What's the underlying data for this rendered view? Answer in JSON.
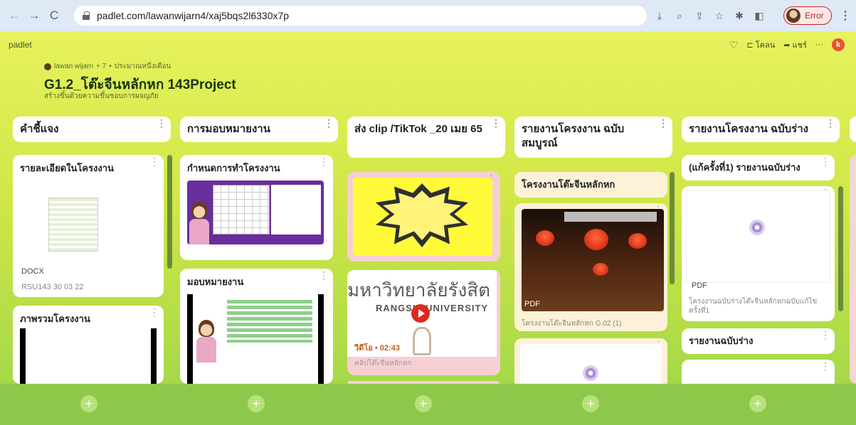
{
  "browser": {
    "url": "padlet.com/lawanwijarn4/xaj5bqs2l6330x7p",
    "profile_label": "Error"
  },
  "padlet": {
    "logo": "padlet",
    "top_actions": {
      "remake": "โคลน",
      "share": "แชร์",
      "user_initial": "k"
    },
    "author": "lawan wijarn",
    "plus": "+ 7",
    "time": "ประมาณหนึ่งเดือน",
    "title": "G1.2_โต๊ะจีนหลักหก 143Project",
    "subtitle": "สร้างขึ้นด้วยความขึ้นชอบการผจญภัย"
  },
  "columns": [
    {
      "title": "คำชี้แจง"
    },
    {
      "title": "การมอบหมายงาน"
    },
    {
      "title": "ส่ง clip /TikTok _20 เมย 65"
    },
    {
      "title": "รายงานโครงงาน ฉบับสมบูรณ์"
    },
    {
      "title": "รายงานโครงงาน ฉบับร่าง"
    }
  ],
  "cards": {
    "c1_card1": {
      "title": "รายละเอียดในโครงงาน",
      "file_type": "DOCX",
      "file_name": "RSU143 30 03 22"
    },
    "c1_card2": {
      "title": "ภาพรวมโครงงาน"
    },
    "c2_card1": {
      "title": "กำหนดการทำโครงงาน"
    },
    "c2_card2": {
      "title": "มอบหมายงาน"
    },
    "c3_card2": {
      "thai_text": "มหาวิทยาลัยรังสิต",
      "eng_text": "RANGSIT UNIVERSITY",
      "duration": "วีดีโอ • 02:43",
      "caption": "คลิปโต๊ะจีนหลักหก"
    },
    "c4_card1": {
      "title": "โครงงานโต๊ะจีนหลักหก"
    },
    "c4_card2": {
      "file_type": "PDF",
      "file_name": "โครงงานโต๊ะจีนหลักหก G.02 (1)"
    },
    "c5_card1": {
      "title": "(แก้ครั้งที่1) รายงานฉบับร่าง"
    },
    "c5_card2": {
      "file_type": "PDF",
      "file_name": "โครงงานฉบับร่างโต๊ะจีนหลักหกฉบับแก้ไขครั้งที่1"
    },
    "c5_card3": {
      "title": "รายงานฉบับร่าง"
    }
  }
}
